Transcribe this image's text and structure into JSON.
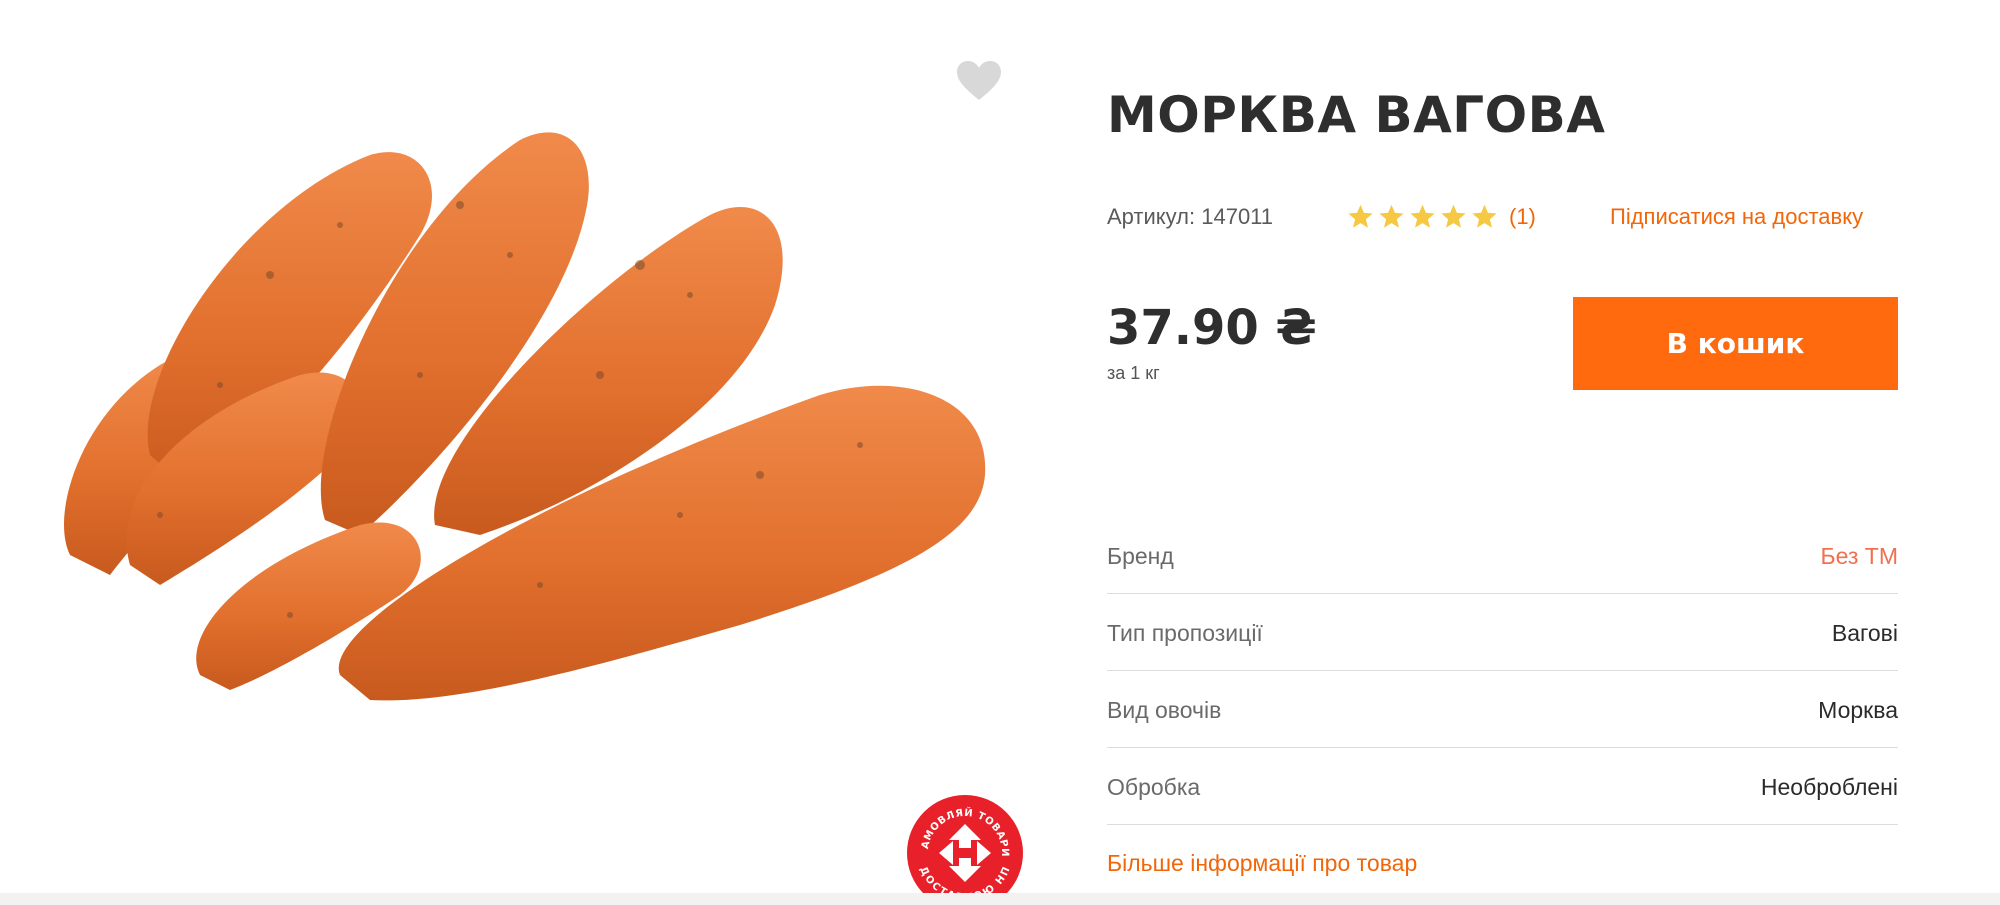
{
  "product": {
    "title": "МОРКВА ВАГОВА",
    "sku": "Артикул: 147011",
    "rating": 5,
    "rating_max": 5,
    "rating_count": "(1)",
    "subscribe_label": "Підписатися на доставку",
    "price": "37.90 ₴",
    "unit": "за 1 кг",
    "cart_button": "В кошик",
    "image_icon": "carrots-image",
    "favorite_icon": "heart-icon"
  },
  "attributes": [
    {
      "label": "Бренд",
      "value": "Без ТМ"
    },
    {
      "label": "Тип пропозиції",
      "value": "Вагові"
    },
    {
      "label": "Вид овочів",
      "value": "Морква"
    },
    {
      "label": "Обробка",
      "value": "Необроблені"
    }
  ],
  "more_info_label": "Більше інформації про товар",
  "badge": {
    "top_text": "ЗАМОВЛЯЙ ТОВАРИ",
    "bottom_text": "ДОСТАВКОЮ НП"
  },
  "colors": {
    "accent": "#ff6a0e",
    "link": "#f2660a",
    "brand_link": "#f07050",
    "star": "#f6c944",
    "badge_red": "#e8202a"
  }
}
